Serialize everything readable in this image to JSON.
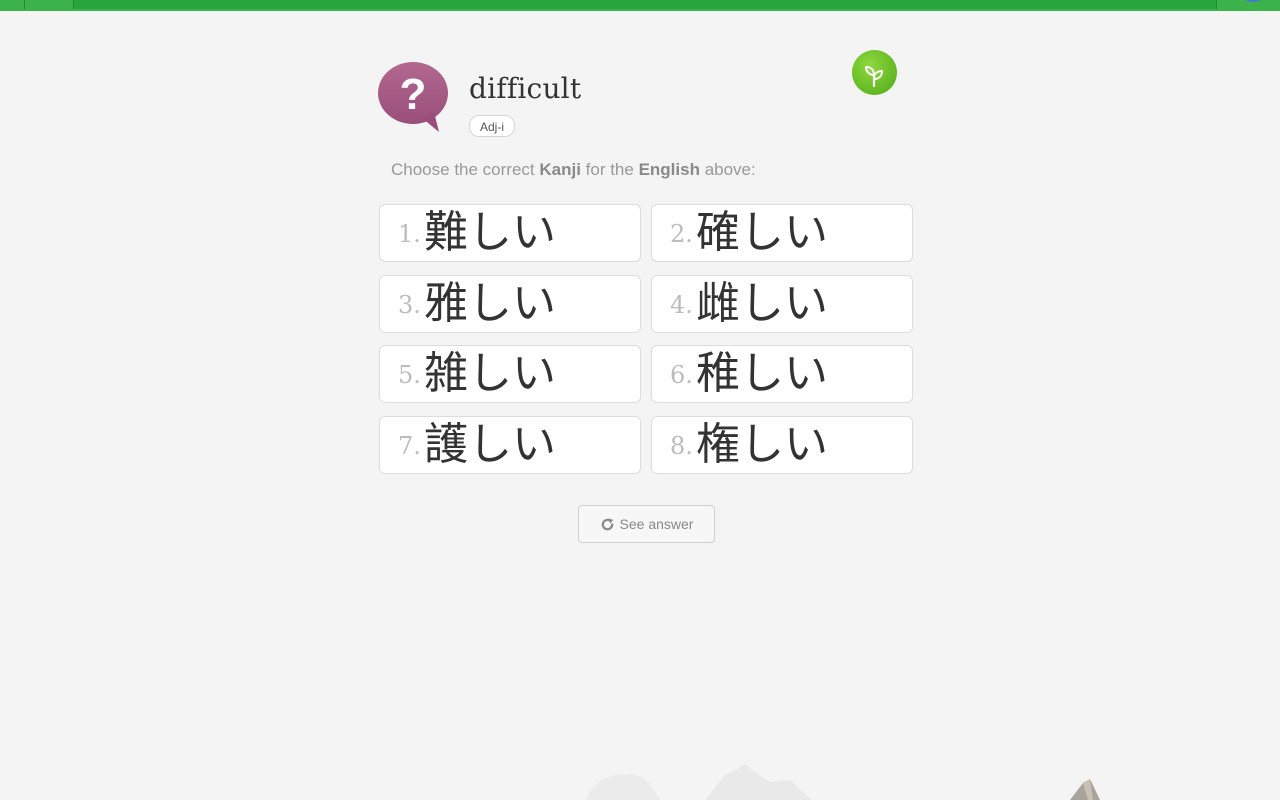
{
  "question": {
    "english_word": "difficult",
    "part_of_speech": "Adj-i",
    "instruction_prefix": "Choose the correct ",
    "instruction_kanji": "Kanji",
    "instruction_middle": " for the ",
    "instruction_english": "English",
    "instruction_suffix": " above:"
  },
  "options": [
    {
      "number": "1.",
      "text": "難しい"
    },
    {
      "number": "2.",
      "text": "確しい"
    },
    {
      "number": "3.",
      "text": "雅しい"
    },
    {
      "number": "4.",
      "text": "雌しい"
    },
    {
      "number": "5.",
      "text": "雑しい"
    },
    {
      "number": "6.",
      "text": "稚しい"
    },
    {
      "number": "7.",
      "text": "護しい"
    },
    {
      "number": "8.",
      "text": "権しい"
    }
  ],
  "actions": {
    "see_answer_label": "See answer"
  },
  "icons": {
    "question": "question-bubble-icon",
    "progress": "sprout-icon",
    "refresh": "refresh-icon"
  },
  "colors": {
    "topbar": "#3cb34a",
    "question_bubble": "#a65a86",
    "sprout": "#6cc127"
  }
}
